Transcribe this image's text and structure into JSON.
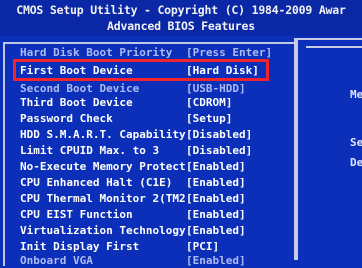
{
  "header": {
    "line1": "CMOS Setup Utility - Copyright (C) 1984-2009 Awar",
    "line2": "Advanced BIOS Features"
  },
  "items": [
    {
      "label": "Hard Disk Boot Priority",
      "value": "[Press Enter]"
    },
    {
      "label": "First Boot Device",
      "value": "[Hard Disk]"
    },
    {
      "label": "Second Boot Device",
      "value": "[USB-HDD]"
    },
    {
      "label": "Third Boot Device",
      "value": "[CDROM]"
    },
    {
      "label": "Password Check",
      "value": "[Setup]"
    },
    {
      "label": "HDD S.M.A.R.T. Capability",
      "value": "[Disabled]"
    },
    {
      "label": "Limit CPUID Max. to 3",
      "value": "[Disabled]"
    },
    {
      "label": "No-Execute Memory Protect",
      "value": "[Enabled]"
    },
    {
      "label": "CPU Enhanced Halt (C1E)",
      "value": "[Enabled]"
    },
    {
      "label": "CPU Thermal Monitor 2(TM2)",
      "value": "[Enabled]"
    },
    {
      "label": "CPU EIST Function",
      "value": "[Enabled]"
    },
    {
      "label": "Virtualization Technology",
      "value": "[Enabled]"
    },
    {
      "label": "Init Display First",
      "value": "[PCI]"
    },
    {
      "label": "Onboard VGA",
      "value": "[Enabled]"
    }
  ],
  "side": {
    "lines": [
      "Me",
      "Se",
      "De"
    ]
  },
  "colors": {
    "background": "#0b2fb8",
    "highlight_border": "#f2242b"
  }
}
